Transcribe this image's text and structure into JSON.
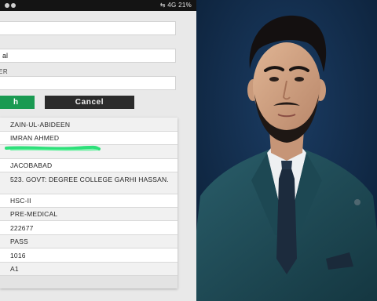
{
  "status_bar": {
    "right_text": "4G  21%"
  },
  "form": {
    "field1_value": "",
    "field2_value": "al",
    "field3_label": "ER",
    "field3_value": "",
    "search_label": "h",
    "cancel_label": "Cancel"
  },
  "results": {
    "rows": [
      {
        "value": "ZAIN-UL-ABIDEEN"
      },
      {
        "value": "IMRAN AHMED"
      },
      {
        "value": ""
      },
      {
        "value": "JACOBABAD"
      },
      {
        "value": "523. GOVT: DEGREE COLLEGE GARHI HASSAN."
      },
      {
        "value": "HSC-II"
      },
      {
        "value": "PRE-MEDICAL"
      },
      {
        "value": "222677"
      },
      {
        "value": "PASS"
      },
      {
        "value": "1016"
      },
      {
        "value": "A1"
      }
    ]
  },
  "colors": {
    "search_button": "#1a9a52",
    "cancel_button": "#2b2b2b",
    "scribble": "#2ee07a",
    "photo_background": "#0e2a4a",
    "suit": "#1f4a56"
  }
}
